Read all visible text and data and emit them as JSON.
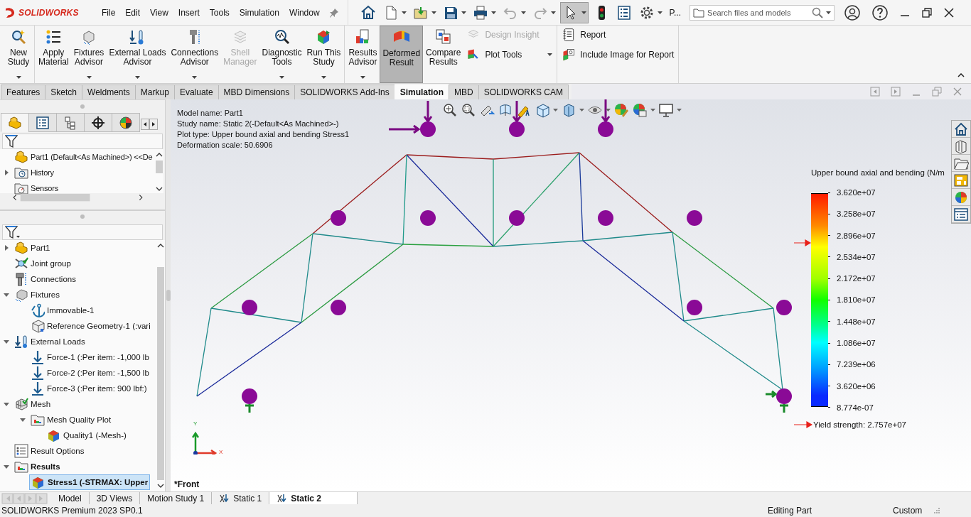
{
  "app": {
    "logo": "SOLIDWORKS"
  },
  "menu": [
    {
      "label": "File"
    },
    {
      "label": "Edit"
    },
    {
      "label": "View"
    },
    {
      "label": "Insert"
    },
    {
      "label": "Tools"
    },
    {
      "label": "Simulation"
    },
    {
      "label": "Window"
    }
  ],
  "toolbar": {
    "overflow": "P...",
    "search": {
      "placeholder": "Search files and models"
    }
  },
  "ribbon": {
    "groups": [
      {
        "items": [
          {
            "label": "New\nStudy",
            "kind": "large",
            "dropdown": true,
            "disabled": false,
            "selected": false
          }
        ]
      },
      {
        "items": [
          {
            "label": "Apply\nMaterial",
            "kind": "large",
            "dropdown": false,
            "disabled": false,
            "selected": false
          },
          {
            "label": "Fixtures\nAdvisor",
            "kind": "large",
            "dropdown": true,
            "disabled": false,
            "selected": false
          },
          {
            "label": "External Loads\nAdvisor",
            "kind": "large",
            "dropdown": true,
            "disabled": false,
            "selected": false
          },
          {
            "label": "Connections\nAdvisor",
            "kind": "large",
            "dropdown": true,
            "disabled": false,
            "selected": false
          },
          {
            "label": "Shell\nManager",
            "kind": "large",
            "dropdown": false,
            "disabled": true,
            "selected": false
          },
          {
            "label": "Diagnostic\nTools",
            "kind": "large",
            "dropdown": true,
            "disabled": false,
            "selected": false
          },
          {
            "label": "Run This\nStudy",
            "kind": "large",
            "dropdown": true,
            "disabled": false,
            "selected": false
          }
        ]
      },
      {
        "items": [
          {
            "label": "Results\nAdvisor",
            "kind": "large",
            "dropdown": true,
            "disabled": false,
            "selected": false
          },
          {
            "label": "Deformed\nResult",
            "kind": "large",
            "dropdown": false,
            "disabled": false,
            "selected": true
          },
          {
            "label": "Compare\nResults",
            "kind": "large",
            "dropdown": false,
            "disabled": false,
            "selected": false
          },
          {
            "label": "Design Insight",
            "kind": "small",
            "dropdown": false,
            "disabled": true,
            "selected": false
          },
          {
            "label": "Plot Tools",
            "kind": "small",
            "dropdown": true,
            "disabled": false,
            "selected": false
          }
        ]
      },
      {
        "items": [
          {
            "label": "Report",
            "kind": "small",
            "dropdown": false,
            "disabled": false,
            "selected": false
          },
          {
            "label": "Include Image for Report",
            "kind": "small",
            "dropdown": false,
            "disabled": false,
            "selected": false
          }
        ]
      }
    ]
  },
  "command_tabs": [
    {
      "label": "Features",
      "selected": false
    },
    {
      "label": "Sketch",
      "selected": false
    },
    {
      "label": "Weldments",
      "selected": false
    },
    {
      "label": "Markup",
      "selected": false
    },
    {
      "label": "Evaluate",
      "selected": false
    },
    {
      "label": "MBD Dimensions",
      "selected": false
    },
    {
      "label": "SOLIDWORKS Add-Ins",
      "selected": false
    },
    {
      "label": "Simulation",
      "selected": true
    },
    {
      "label": "MBD",
      "selected": false
    },
    {
      "label": "SOLIDWORKS CAM",
      "selected": false
    }
  ],
  "feature_manager": {
    "tabs": [
      {
        "selected": true
      },
      {
        "selected": false
      },
      {
        "selected": false
      },
      {
        "selected": false
      },
      {
        "selected": false
      }
    ],
    "tree": [
      {
        "label": "Part1 (Default<As Machined>) <<De",
        "kind": "part"
      },
      {
        "label": "History",
        "kind": "history",
        "expanded": false
      },
      {
        "label": "Sensors",
        "kind": "sensors"
      }
    ]
  },
  "simulation_tree": [
    {
      "label": "Part1",
      "kind": "part",
      "expanded": false
    },
    {
      "label": "Joint group",
      "kind": "joint"
    },
    {
      "label": "Connections",
      "kind": "connections"
    },
    {
      "label": "Fixtures",
      "kind": "fixtures",
      "expanded": true,
      "children": [
        {
          "label": "Immovable-1",
          "kind": "anchor"
        },
        {
          "label": "Reference Geometry-1 (:vari",
          "kind": "geometry"
        }
      ]
    },
    {
      "label": "External Loads",
      "kind": "loads",
      "expanded": true,
      "children": [
        {
          "label": "Force-1 (:Per item: -1,000 lb",
          "kind": "force"
        },
        {
          "label": "Force-2 (:Per item: -1,500 lb",
          "kind": "force"
        },
        {
          "label": "Force-3 (:Per item: 900 lbf:)",
          "kind": "force"
        }
      ]
    },
    {
      "label": "Mesh",
      "kind": "mesh",
      "expanded": true,
      "children": [
        {
          "label": "Mesh Quality Plot",
          "kind": "plotfolder",
          "expanded": true,
          "children": [
            {
              "label": "Quality1 (-Mesh-)",
              "kind": "plot"
            }
          ]
        }
      ]
    },
    {
      "label": "Result Options",
      "kind": "options"
    },
    {
      "label": "Results",
      "kind": "plotfolder",
      "expanded": true,
      "bold": true,
      "children": [
        {
          "label": "Stress1 (-STRMAX: Upper",
          "kind": "plot",
          "bold": true,
          "selected": true
        }
      ]
    }
  ],
  "viewport": {
    "info": [
      "Model name: Part1",
      "Study name: Static 2(-Default<As Machined>-)",
      "Plot type: Upper bound axial and bending Stress1",
      "Deformation scale: 50.6906"
    ],
    "view": "*Front",
    "axes": {
      "y": "Y",
      "x": "X"
    },
    "legend": {
      "title": "Upper bound axial and bending (N/m",
      "labels": [
        "3.620e+07",
        "3.258e+07",
        "2.896e+07",
        "2.534e+07",
        "2.172e+07",
        "1.810e+07",
        "1.448e+07",
        "1.086e+07",
        "7.239e+06",
        "3.620e+06",
        "8.774e-07"
      ],
      "yield": "Yield strength: 2.757e+07"
    }
  },
  "bottom_tabs": [
    {
      "label": "Model",
      "kind": "plain",
      "selected": false
    },
    {
      "label": "3D Views",
      "kind": "plain",
      "selected": false
    },
    {
      "label": "Motion Study 1",
      "kind": "plain",
      "selected": false
    },
    {
      "label": "Static 1",
      "kind": "study",
      "selected": false
    },
    {
      "label": "Static 2",
      "kind": "study",
      "selected": true
    }
  ],
  "status_bar": {
    "product": "SOLIDWORKS Premium 2023 SP0.1",
    "mode": "Editing Part",
    "units": "Custom"
  }
}
